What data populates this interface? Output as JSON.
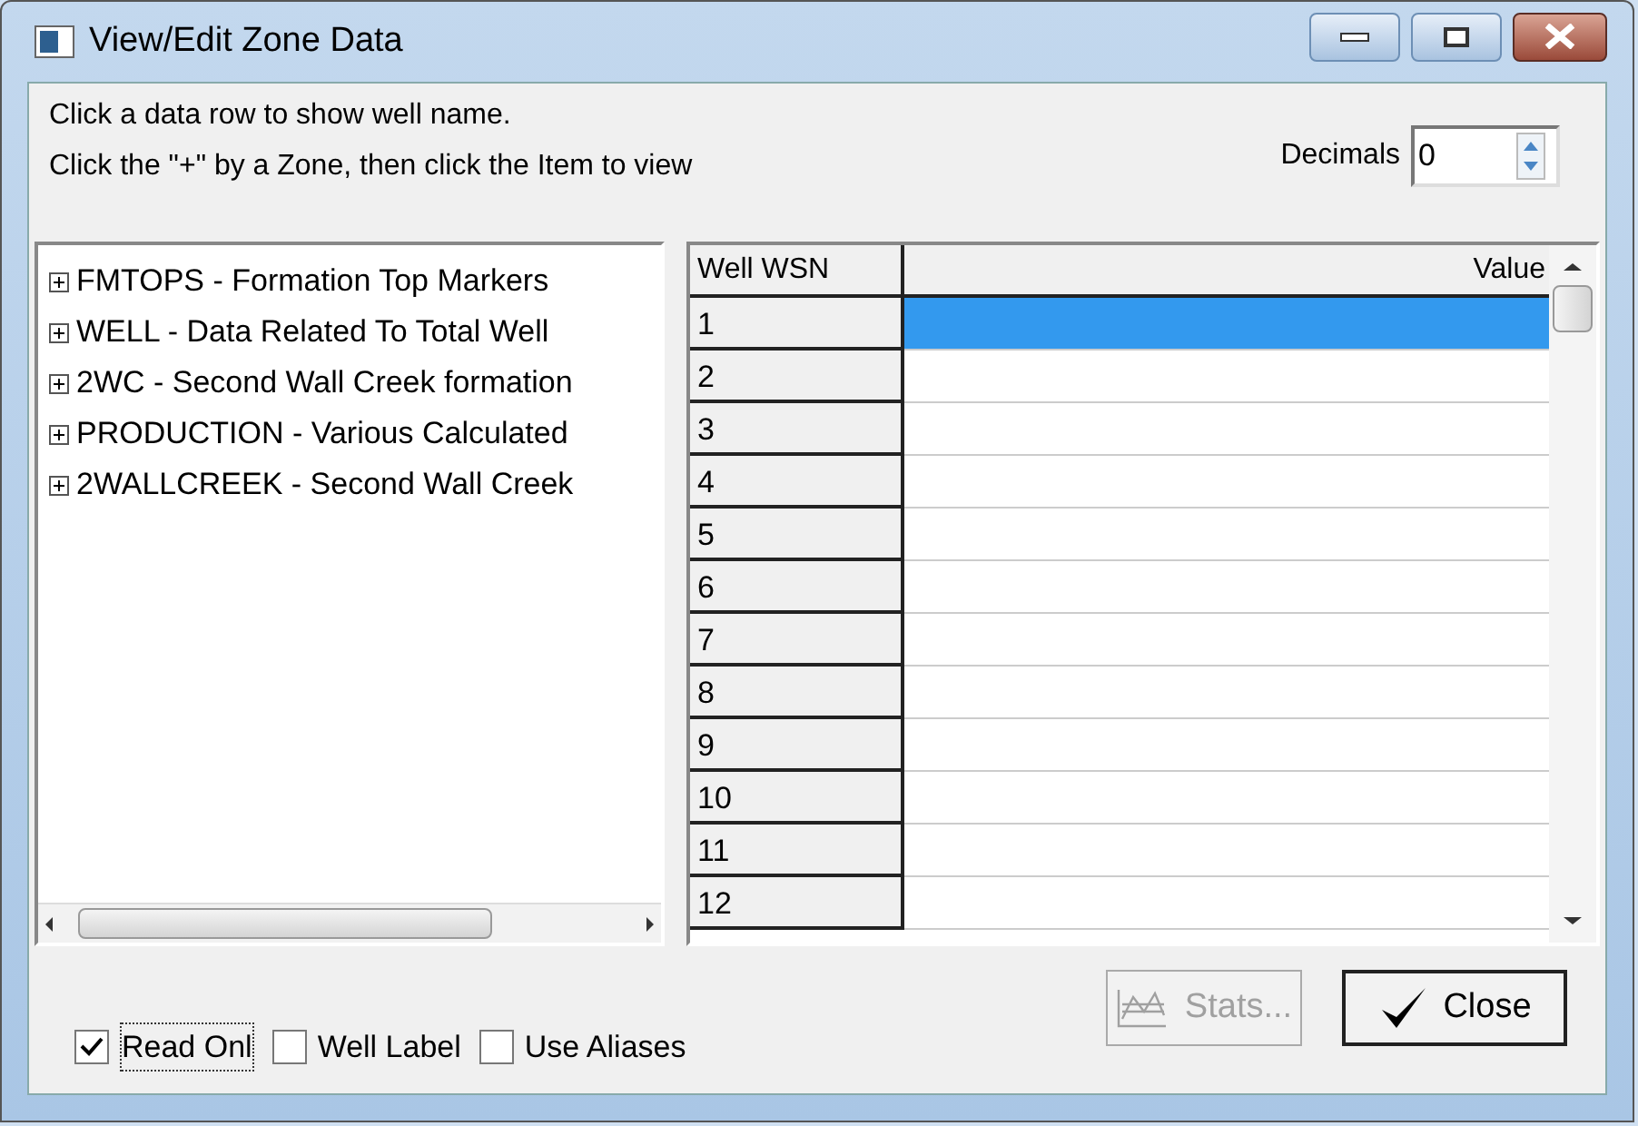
{
  "window": {
    "title": "View/Edit Zone Data"
  },
  "instructions": [
    "Click a data row to show well name.",
    "Click the \"+\" by a Zone, then click the Item to view"
  ],
  "decimals": {
    "label": "Decimals",
    "value": "0"
  },
  "tree": {
    "items": [
      {
        "label": "FMTOPS - Formation Top Markers",
        "expanded": false
      },
      {
        "label": "WELL - Data Related To Total Well",
        "expanded": false
      },
      {
        "label": "2WC - Second Wall Creek formation",
        "expanded": false
      },
      {
        "label": "PRODUCTION - Various Calculated",
        "expanded": false
      },
      {
        "label": "2WALLCREEK - Second Wall Creek",
        "expanded": false
      }
    ]
  },
  "grid": {
    "columns": [
      "Well WSN",
      "Value"
    ],
    "rows": [
      {
        "wsn": "1",
        "selected": true
      },
      {
        "wsn": "2",
        "selected": false
      },
      {
        "wsn": "3",
        "selected": false
      },
      {
        "wsn": "4",
        "selected": false
      },
      {
        "wsn": "5",
        "selected": false
      },
      {
        "wsn": "6",
        "selected": false
      },
      {
        "wsn": "7",
        "selected": false
      },
      {
        "wsn": "8",
        "selected": false
      },
      {
        "wsn": "9",
        "selected": false
      },
      {
        "wsn": "10",
        "selected": false
      },
      {
        "wsn": "11",
        "selected": false
      },
      {
        "wsn": "12",
        "selected": false
      }
    ]
  },
  "checkboxes": [
    {
      "label": "Read Onl",
      "checked": true
    },
    {
      "label": "Well Label",
      "checked": false
    },
    {
      "label": "Use Aliases",
      "checked": false
    }
  ],
  "buttons": [
    {
      "kind": "stats",
      "label": "Stats...",
      "disabled": true
    },
    {
      "kind": "close",
      "label": "Close",
      "disabled": false
    }
  ]
}
